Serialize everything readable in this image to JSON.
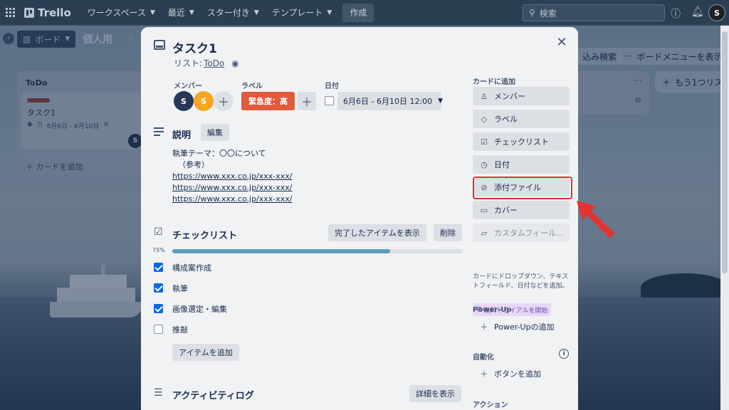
{
  "topnav": {
    "logo": "Trello",
    "items": [
      {
        "label": "ワークスペース"
      },
      {
        "label": "最近"
      },
      {
        "label": "スター付き"
      },
      {
        "label": "テンプレート"
      }
    ],
    "create_label": "作成",
    "search_placeholder": "検索",
    "avatar_initial": "S"
  },
  "board": {
    "view_label": "ボード",
    "title": "個人用",
    "filter_label": "込み検索",
    "menu_label": "ボードメニューを表示",
    "lists": [
      {
        "title": "ToDo",
        "cards": [
          {
            "title": "タスク1",
            "dates": "6月6日 - 6月10日",
            "avatar": "S"
          }
        ],
        "add_label": "カードを追加"
      }
    ],
    "add_list_label": "もう1つリス"
  },
  "modal": {
    "title": "タスク1",
    "list_prefix": "リスト:",
    "list_name": "ToDo",
    "members_label": "メンバー",
    "members": [
      {
        "initial": "S",
        "color": "#253858"
      },
      {
        "initial": "S",
        "color": "#f5a623"
      }
    ],
    "labels_label": "ラベル",
    "label_text": "緊急度：高",
    "label_color": "#e05a3d",
    "date_label": "日付",
    "date_value": "6月6日 - 6月10日 12:00",
    "description": {
      "title": "説明",
      "edit_label": "編集",
      "lines": [
        "執筆テーマ：〇〇について",
        "（参考）",
        "https://www.xxx.co.jp/xxx-xxx/",
        "https://www.xxx.co.jp/xxx-xxx/",
        "https://www.xxx.co.jp/xxx-xxx/"
      ]
    },
    "checklist": {
      "title": "チェックリスト",
      "show_done_label": "完了したアイテムを表示",
      "delete_label": "削除",
      "percent_label": "75%",
      "progress": 0.75,
      "items": [
        {
          "text": "構成案作成",
          "checked": true
        },
        {
          "text": "執筆",
          "checked": true
        },
        {
          "text": "画像選定・編集",
          "checked": true
        },
        {
          "text": "推敲",
          "checked": false
        }
      ],
      "add_item_label": "アイテムを追加"
    },
    "activity": {
      "title": "アクティビティログ",
      "details_label": "詳細を表示"
    },
    "sidebar": {
      "add_to_card_label": "カードに追加",
      "buttons": [
        {
          "label": "メンバー",
          "icon": "person-icon"
        },
        {
          "label": "ラベル",
          "icon": "tag-icon"
        },
        {
          "label": "チェックリスト",
          "icon": "checklist-icon"
        },
        {
          "label": "日付",
          "icon": "clock-icon"
        },
        {
          "label": "添付ファイル",
          "icon": "paperclip-icon"
        },
        {
          "label": "カバー",
          "icon": "cover-icon"
        },
        {
          "label": "カスタムフィール...",
          "icon": "field-icon"
        }
      ],
      "custom_note": "カードにドロップダウン、テキストフィールド、日付などを追加。",
      "trial_label": "無料トライアルを開始",
      "powerup_label": "Power-Up",
      "powerup_add_label": "Power-Upの追加",
      "automation_label": "自動化",
      "add_button_label": "ボタンを追加",
      "actions_label": "アクション"
    }
  },
  "colors": {
    "highlight": "#e3342f",
    "arrow": "#e3342f",
    "progress": "#5b9bbe"
  }
}
